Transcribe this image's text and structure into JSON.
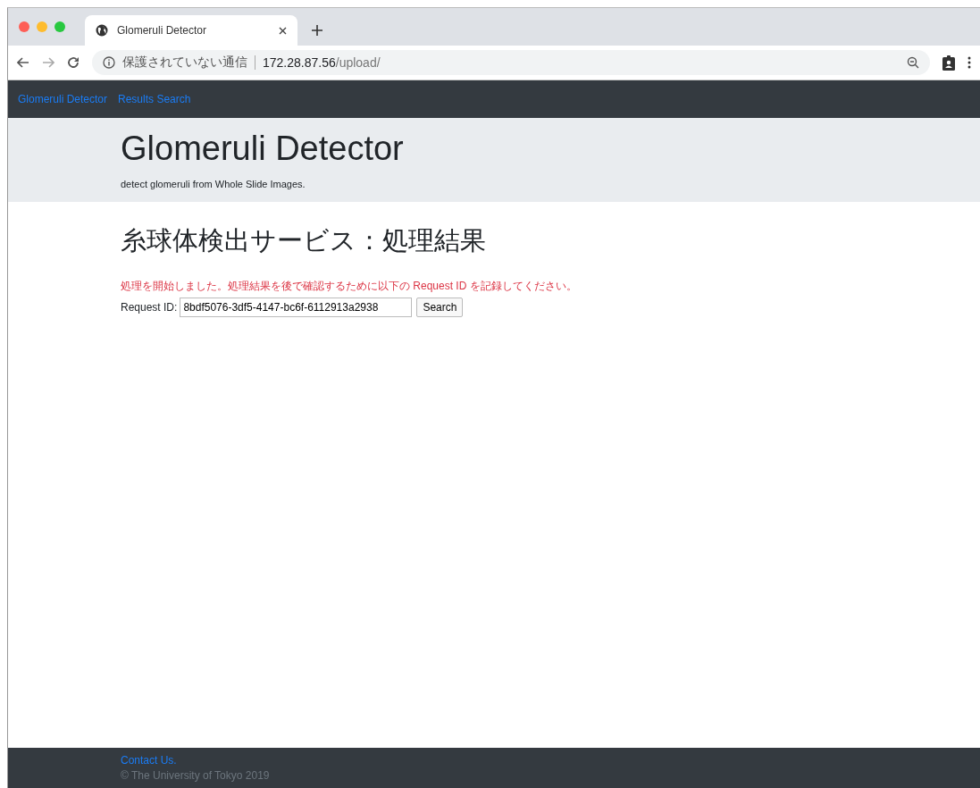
{
  "window": {
    "tab": {
      "title": "Glomeruli Detector",
      "selected": true
    },
    "address_bar": {
      "security_label": "保護されていない通信",
      "host": "172.28.87.56",
      "path": "/upload/"
    }
  },
  "navbar": {
    "links": [
      {
        "label": "Glomeruli Detector"
      },
      {
        "label": "Results Search"
      }
    ]
  },
  "header": {
    "title": "Glomeruli Detector",
    "subtitle": "detect glomeruli from Whole Slide Images."
  },
  "main": {
    "heading": "糸球体検出サービス：処理結果",
    "notice": "処理を開始しました。処理結果を後で確認するために以下の Request ID を記録してください。",
    "field_label": "Request ID:",
    "request_id": "8bdf5076-3df5-4147-bc6f-6112913a2938",
    "button": "Search"
  },
  "footer": {
    "link": "Contact Us.",
    "copyright": "© The University of Tokyo 2019"
  }
}
